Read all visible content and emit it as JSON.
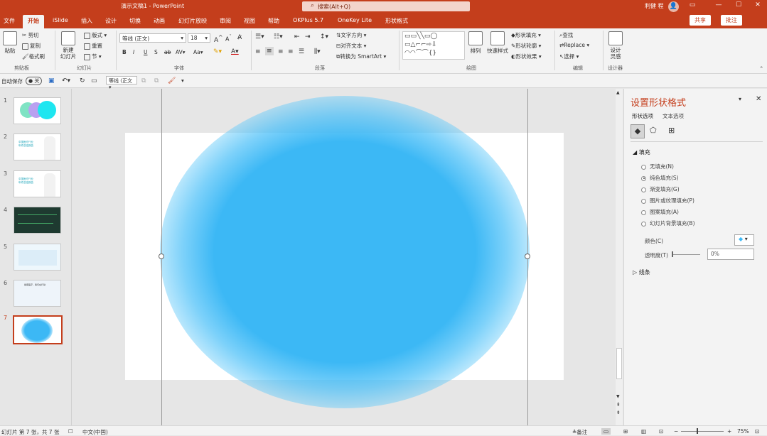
{
  "titlebar": {
    "doc_title": "演示文稿1 - PowerPoint",
    "search_placeholder": "搜索(Alt+Q)",
    "user_name": "利健 程"
  },
  "tabs": [
    "文件",
    "开始",
    "iSlide",
    "插入",
    "设计",
    "切换",
    "动画",
    "幻灯片放映",
    "审阅",
    "视图",
    "帮助",
    "OKPlus 5.7",
    "OneKey Lite",
    "形状格式"
  ],
  "active_tab": "开始",
  "actions": {
    "share": "共享",
    "comment": "批注"
  },
  "ribbon": {
    "clipboard": {
      "paste": "粘贴",
      "cut": "剪切",
      "copy": "复制",
      "format_painter": "格式刷",
      "label": "剪贴板"
    },
    "slides": {
      "new_slide": "新建\n幻灯片",
      "layout": "版式",
      "reset": "重置",
      "section": "节",
      "label": "幻灯片"
    },
    "font": {
      "name": "等线 (正文)",
      "size": "18",
      "bold": "B",
      "italic": "I",
      "underline": "U",
      "shadow": "S",
      "strike": "ab",
      "spacing": "AV",
      "case": "Aa",
      "label": "字体"
    },
    "paragraph": {
      "text_direction": "文字方向",
      "align_text": "对齐文本",
      "smartart": "转换为 SmartArt",
      "label": "段落"
    },
    "drawing": {
      "arrange": "排列",
      "quick_styles": "快速样式",
      "fill": "形状填充",
      "outline": "形状轮廓",
      "effects": "形状效果",
      "label": "绘图"
    },
    "editing": {
      "find": "查找",
      "replace": "Replace",
      "select": "选择",
      "label": "编辑"
    },
    "designer": {
      "btn": "设计\n灵感",
      "label": "设计器"
    }
  },
  "qat": {
    "autosave": "自动保存",
    "autosave_state": "关",
    "font": "等线 (正文"
  },
  "thumbnails": [
    {
      "num": "1"
    },
    {
      "num": "2",
      "text": "中国医疗行业\n年终总结报告"
    },
    {
      "num": "3",
      "text": "中国医疗行业\n年终总结报告"
    },
    {
      "num": "4"
    },
    {
      "num": "5"
    },
    {
      "num": "6",
      "text": "健康医疗，我们在行动"
    },
    {
      "num": "7"
    }
  ],
  "format_pane": {
    "title": "设置形状格式",
    "tabs": [
      "形状选项",
      "文本选项"
    ],
    "fill_section": "填充",
    "fill_options": [
      "无填充(N)",
      "纯色填充(S)",
      "渐变填充(G)",
      "图片或纹理填充(P)",
      "图案填充(A)",
      "幻灯片背景填充(B)"
    ],
    "selected_fill": "纯色填充(S)",
    "color_label": "颜色(C)",
    "transparency_label": "透明度(T)",
    "transparency_value": "0%",
    "line_section": "线条"
  },
  "status": {
    "slide_info": "幻灯片 第 7 张，共 7 张",
    "language": "中文(中国)",
    "notes": "备注",
    "zoom": "75%"
  },
  "colors": {
    "accent": "#c43e1c",
    "blob": "#3cb8f5"
  }
}
